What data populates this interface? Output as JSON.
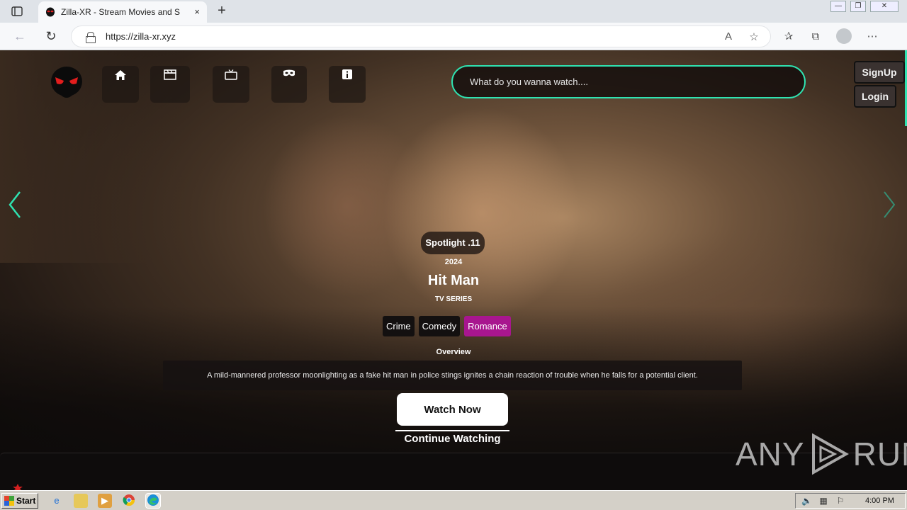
{
  "browser": {
    "tab_title": "Zilla-XR - Stream Movies and Series",
    "url": "https://zilla-xr.xyz",
    "tab_close": "×",
    "new_tab": "+"
  },
  "site": {
    "search_placeholder": "What do you wanna watch....",
    "signup_label": "SignUp",
    "login_label": "Login",
    "nav_icons": [
      "home-icon",
      "movies-icon",
      "tv-icon",
      "anime-mask-icon",
      "info-icon"
    ]
  },
  "spotlight": {
    "label": "Spotlight .11",
    "year": "2024",
    "title": "Hit Man",
    "media_type": "TV SERIES",
    "genres": [
      {
        "label": "Crime",
        "active": false
      },
      {
        "label": "Comedy",
        "active": false
      },
      {
        "label": "Romance",
        "active": true
      }
    ],
    "overview_label": "Overview",
    "overview": "A mild-mannered professor moonlighting as a fake hit man in police stings ignites a chain reaction of trouble when he falls for a potential client.",
    "watch_now_label": "Watch Now",
    "continue_label": "Continue Watching"
  },
  "watermark": {
    "text_left": "ANY",
    "text_right": "RUN"
  },
  "taskbar": {
    "start_label": "Start",
    "clock": "4:00 PM"
  },
  "colors": {
    "accent_teal": "#2fe3b1",
    "genre_active": "#a8168f"
  }
}
